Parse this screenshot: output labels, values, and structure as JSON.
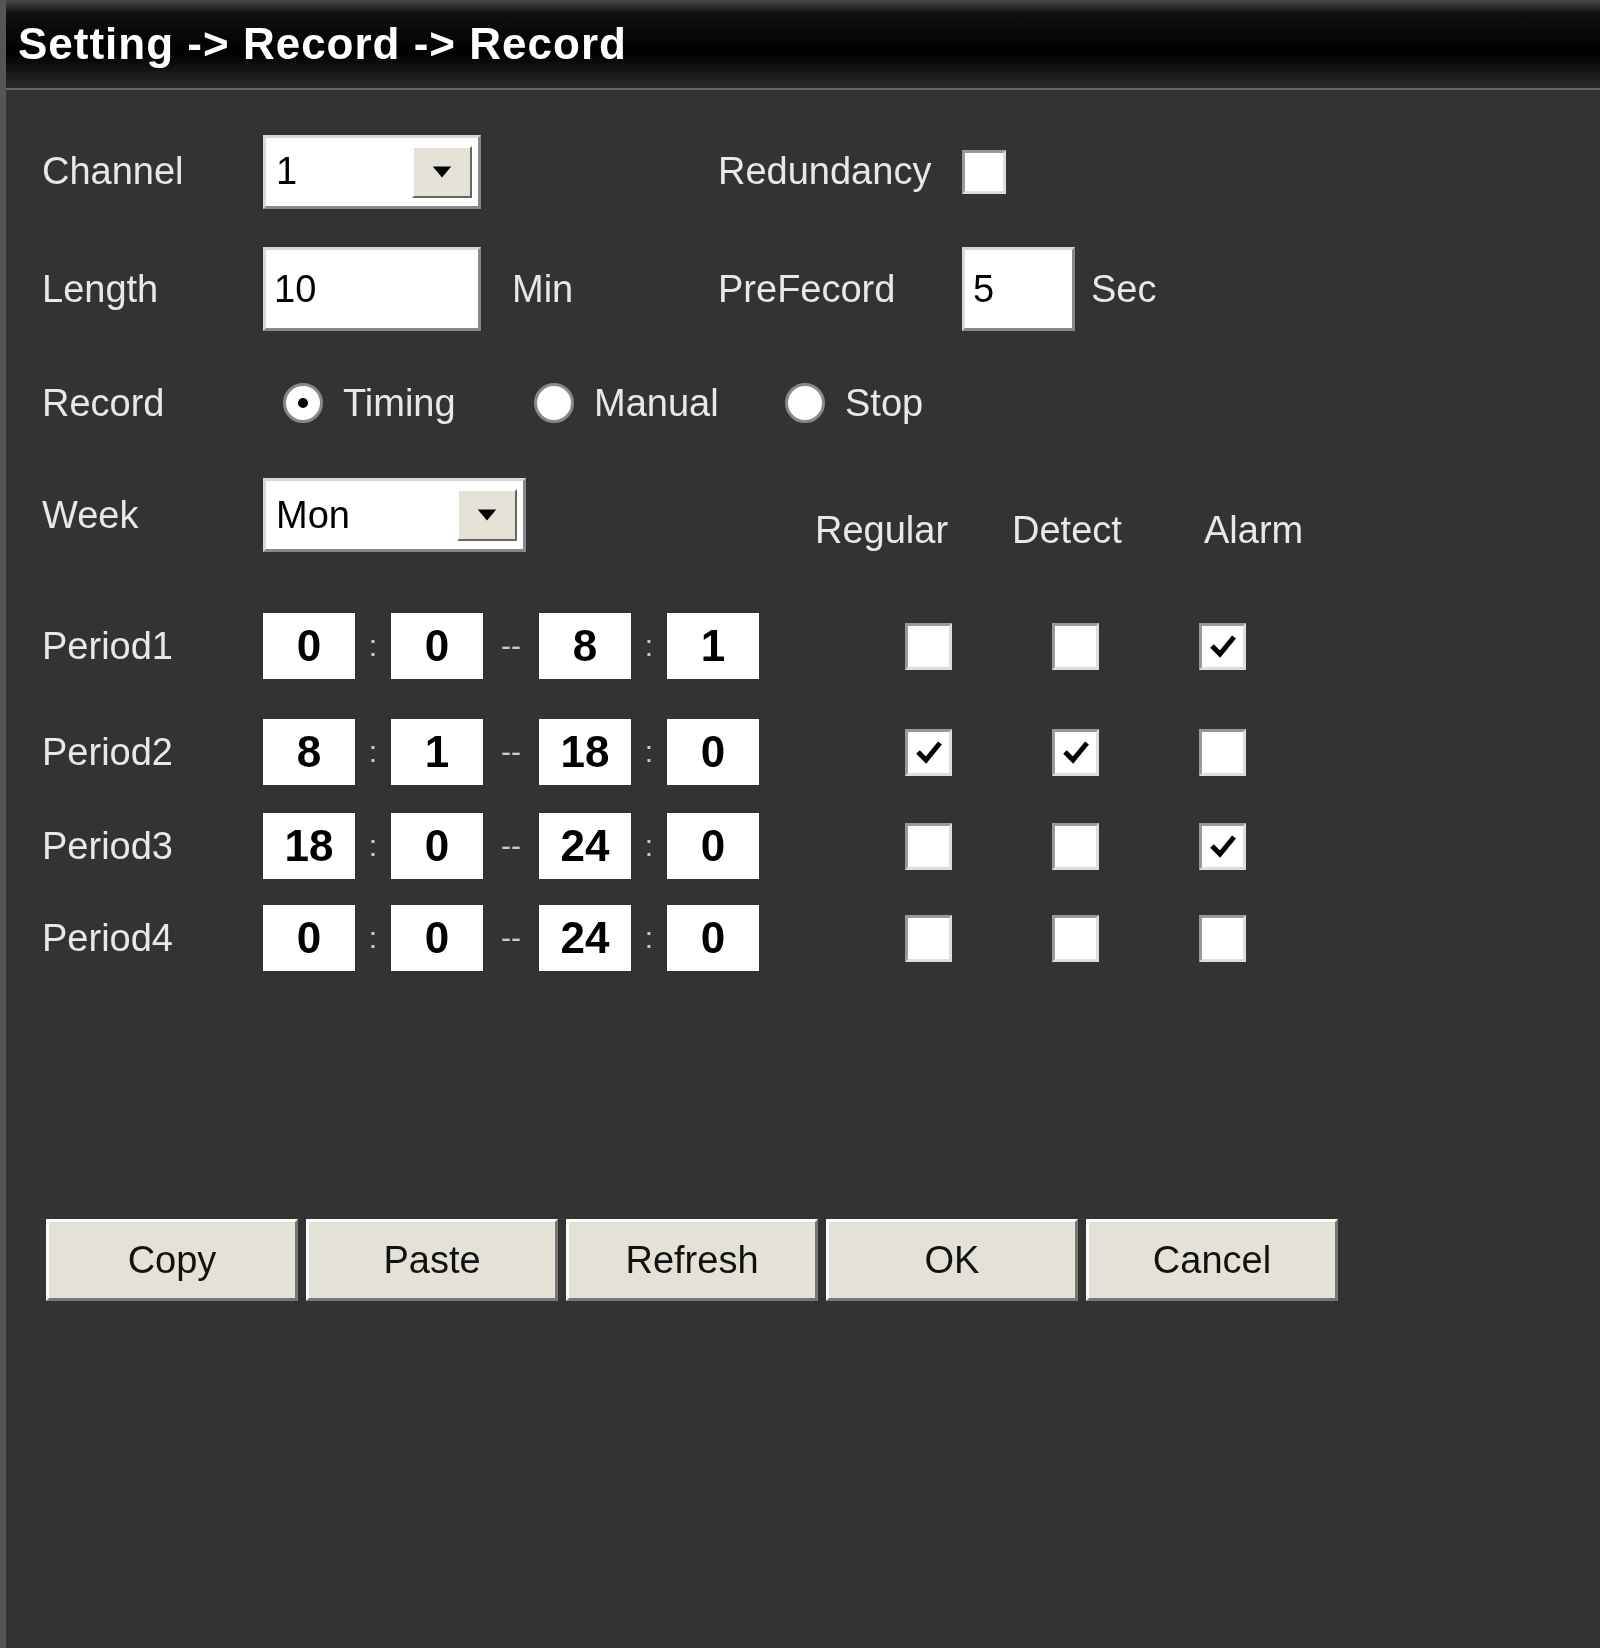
{
  "title": "Setting -> Record -> Record",
  "channel": {
    "label": "Channel",
    "value": "1"
  },
  "redundancy": {
    "label": "Redundancy",
    "checked": false
  },
  "length": {
    "label": "Length",
    "value": "10",
    "unit": "Min"
  },
  "prerecord": {
    "label": "PreFecord",
    "value": "5",
    "unit": "Sec"
  },
  "record": {
    "label": "Record",
    "options": [
      {
        "label": "Timing",
        "selected": true
      },
      {
        "label": "Manual",
        "selected": false
      },
      {
        "label": "Stop",
        "selected": false
      }
    ]
  },
  "week": {
    "label": "Week",
    "value": "Mon"
  },
  "columns": [
    "Regular",
    "Detect",
    "Alarm"
  ],
  "periods": [
    {
      "label": "Period1",
      "start_hour": "0",
      "sep_1": ":",
      "start_minute": "0",
      "range": "--",
      "end_hour": "8",
      "sep_2": ":",
      "end_minute": "1",
      "checks": [
        false,
        false,
        true
      ]
    },
    {
      "label": "Period2",
      "start_hour": "8",
      "sep_1": ":",
      "start_minute": "1",
      "range": "--",
      "end_hour": "18",
      "sep_2": ":",
      "end_minute": "0",
      "checks": [
        true,
        true,
        false
      ]
    },
    {
      "label": "Period3",
      "start_hour": "18",
      "sep_1": ":",
      "start_minute": "0",
      "range": "--",
      "end_hour": "24",
      "sep_2": ":",
      "end_minute": "0",
      "checks": [
        false,
        false,
        true
      ]
    },
    {
      "label": "Period4",
      "start_hour": "0",
      "sep_1": ":",
      "start_minute": "0",
      "range": "--",
      "end_hour": "24",
      "sep_2": ":",
      "end_minute": "0",
      "checks": [
        false,
        false,
        false
      ]
    }
  ],
  "buttons": [
    "Copy",
    "Paste",
    "Refresh",
    "OK",
    "Cancel"
  ]
}
